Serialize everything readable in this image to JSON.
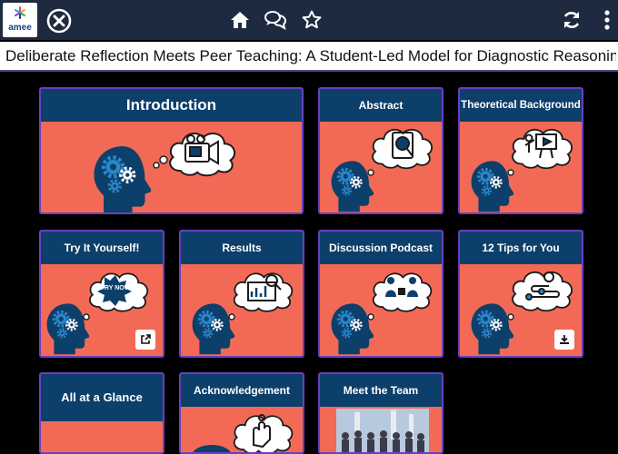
{
  "brand": {
    "name": "amee"
  },
  "page_title": "Deliberate Reflection Meets Peer Teaching: A Student-Led Model for Diagnostic Reasoning ...",
  "colors": {
    "topbar": "#1e2a3f",
    "tile_bg": "#f26a55",
    "tile_header": "#0d3f6b",
    "tile_border": "#6a3fc1"
  },
  "toolbar": {
    "icons": [
      "close-icon",
      "home-icon",
      "chat-bubbles-icon",
      "star-icon",
      "refresh-icon",
      "more-vertical-icon"
    ]
  },
  "tiles": [
    {
      "label": "Introduction",
      "illustration": "video-camera-thought"
    },
    {
      "label": "Abstract",
      "illustration": "magnifier-document-thought"
    },
    {
      "label": "Theoretical Background",
      "illustration": "presentation-board-thought"
    },
    {
      "label": "Try It Yourself!",
      "illustration": "try-now-thought",
      "action_icon": "external-link-icon"
    },
    {
      "label": "Results",
      "illustration": "magnifier-chart-thought"
    },
    {
      "label": "Discussion Podcast",
      "illustration": "podcast-people-thought"
    },
    {
      "label": "12 Tips for You",
      "illustration": "lightbulb-steps-thought",
      "action_icon": "download-icon"
    },
    {
      "label": "All at a Glance"
    },
    {
      "label": "Acknowledgement",
      "illustration": "hand-thought"
    },
    {
      "label": "Meet the Team",
      "illustration": "team-photo"
    }
  ],
  "try_now_text": "TRY NOW"
}
